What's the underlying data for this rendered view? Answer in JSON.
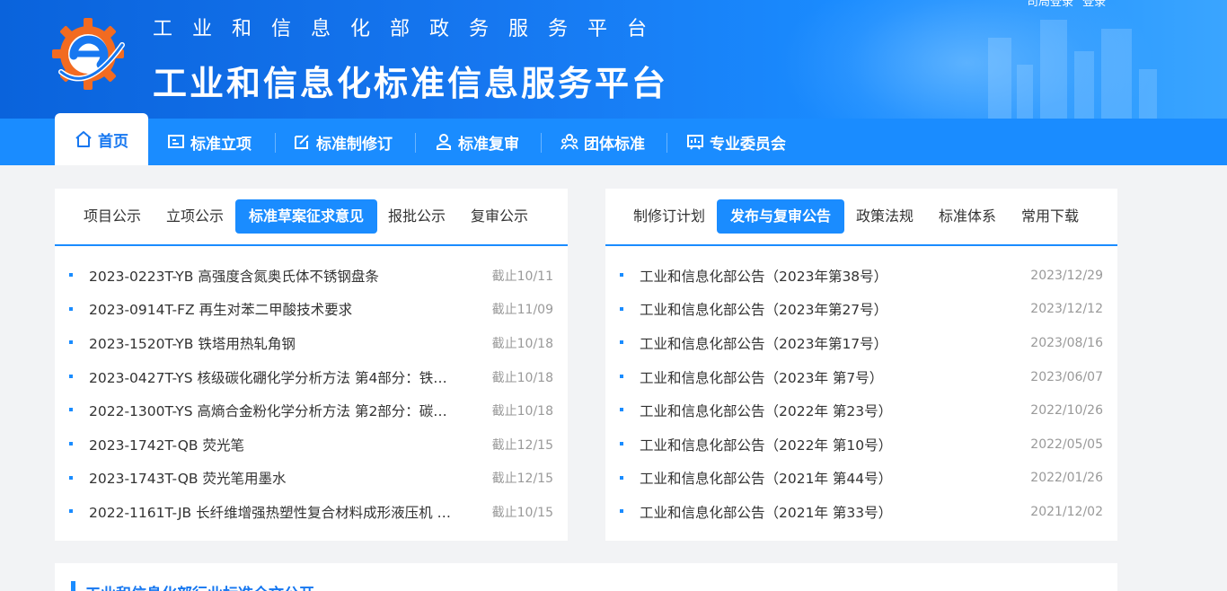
{
  "header": {
    "subtitle": "工业和信息化部政务服务平台",
    "title": "工业和信息化标准信息服务平台",
    "login_links": [
      "司局登录",
      "登录"
    ]
  },
  "nav": {
    "items": [
      {
        "label": "首页",
        "icon": "home-icon"
      },
      {
        "label": "标准立项",
        "icon": "project-icon"
      },
      {
        "label": "标准制修订",
        "icon": "edit-icon"
      },
      {
        "label": "标准复审",
        "icon": "review-icon"
      },
      {
        "label": "团体标准",
        "icon": "group-icon"
      },
      {
        "label": "专业委员会",
        "icon": "committee-icon"
      }
    ],
    "active": "首页"
  },
  "left_panel": {
    "tabs": [
      "项目公示",
      "立项公示",
      "标准草案征求意见",
      "报批公示",
      "复审公示"
    ],
    "active_tab": "标准草案征求意见",
    "rows": [
      {
        "text": "2023-0223T-YB  高强度含氮奥氏体不锈钢盘条",
        "date": "截止10/11"
      },
      {
        "text": "2023-0914T-FZ  再生对苯二甲酸技术要求",
        "date": "截止11/09"
      },
      {
        "text": "2023-1520T-YB  铁塔用热轧角钢",
        "date": "截止10/18"
      },
      {
        "text": "2023-0427T-YS  核级碳化硼化学分析方法 第4部分：铁…",
        "date": "截止10/18"
      },
      {
        "text": "2022-1300T-YS  高熵合金粉化学分析方法 第2部分：碳…",
        "date": "截止10/18"
      },
      {
        "text": "2023-1742T-QB  荧光笔",
        "date": "截止12/15"
      },
      {
        "text": "2023-1743T-QB  荧光笔用墨水",
        "date": "截止12/15"
      },
      {
        "text": "2022-1161T-JB  长纤维增强热塑性复合材料成形液压机 …",
        "date": "截止10/15"
      }
    ]
  },
  "right_panel": {
    "tabs": [
      "制修订计划",
      "发布与复审公告",
      "政策法规",
      "标准体系",
      "常用下载"
    ],
    "active_tab": "发布与复审公告",
    "rows": [
      {
        "text": "工业和信息化部公告（2023年第38号）",
        "date": "2023/12/29"
      },
      {
        "text": "工业和信息化部公告（2023年第27号）",
        "date": "2023/12/12"
      },
      {
        "text": "工业和信息化部公告（2023年第17号）",
        "date": "2023/08/16"
      },
      {
        "text": "工业和信息化部公告（2023年 第7号）",
        "date": "2023/06/07"
      },
      {
        "text": "工业和信息化部公告（2022年 第23号）",
        "date": "2022/10/26"
      },
      {
        "text": "工业和信息化部公告（2022年 第10号）",
        "date": "2022/05/05"
      },
      {
        "text": "工业和信息化部公告（2021年 第44号）",
        "date": "2022/01/26"
      },
      {
        "text": "工业和信息化部公告（2021年 第33号）",
        "date": "2021/12/02"
      }
    ]
  },
  "bottom": {
    "title": "工业和信息化部行业标准全文公开"
  },
  "colors": {
    "primary": "#1a8cff",
    "header_dark": "#0a63dc",
    "logo_orange": "#f26b21"
  }
}
